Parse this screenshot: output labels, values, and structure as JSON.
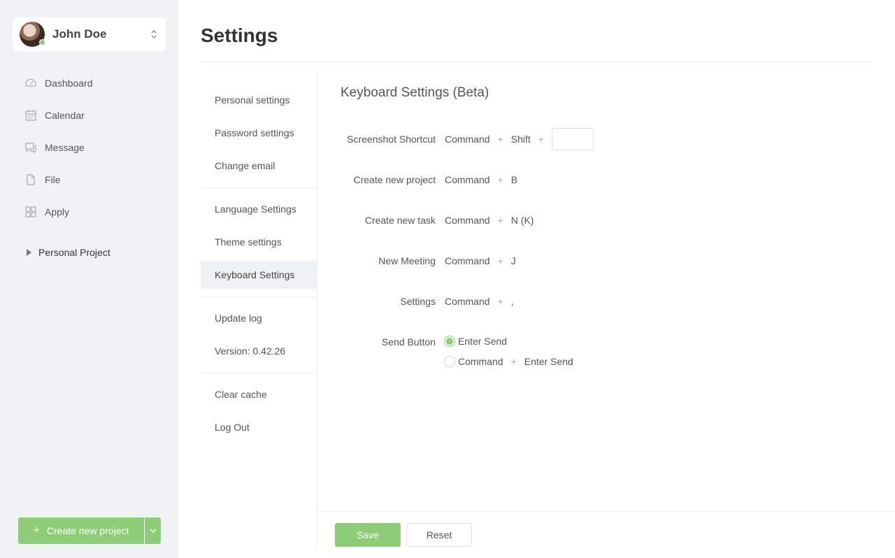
{
  "user": {
    "name": "John Doe"
  },
  "nav": {
    "items": [
      {
        "label": "Dashboard",
        "icon": "dashboard-icon"
      },
      {
        "label": "Calendar",
        "icon": "calendar-icon"
      },
      {
        "label": "Message",
        "icon": "message-icon"
      },
      {
        "label": "File",
        "icon": "file-icon"
      },
      {
        "label": "Apply",
        "icon": "apply-icon"
      }
    ],
    "project": "Personal Project"
  },
  "create_button": {
    "label": "Create new project"
  },
  "page": {
    "title": "Settings"
  },
  "settings_menu": {
    "personal": "Personal settings",
    "password": "Password settings",
    "email": "Change email",
    "language": "Language Settings",
    "theme": "Theme settings",
    "keyboard": "Keyboard Settings",
    "update_log": "Update log",
    "version": "Version: 0.42.26",
    "clear_cache": "Clear cache",
    "logout": "Log Out"
  },
  "keyboard": {
    "title": "Keyboard Settings (Beta)",
    "plus": "+",
    "screenshot": {
      "label": "Screenshot Shortcut",
      "mod1": "Command",
      "mod2": "Shift",
      "key": ""
    },
    "new_project": {
      "label": "Create new project",
      "mod": "Command",
      "key": "B"
    },
    "new_task": {
      "label": "Create new task",
      "mod": "Command",
      "key": "N (K)"
    },
    "new_meeting": {
      "label": "New Meeting",
      "mod": "Command",
      "key": "J"
    },
    "settings": {
      "label": "Settings",
      "mod": "Command",
      "key": ","
    },
    "send_button": {
      "label": "Send Button",
      "option1": "Enter Send",
      "option2_mod": "Command",
      "option2_key": "Enter Send",
      "selected": "option1"
    }
  },
  "footer": {
    "save": "Save",
    "reset": "Reset"
  },
  "colors": {
    "accent": "#8fcc77",
    "sidebar_bg": "#f0f2f5",
    "active_menu_bg": "#eff1f4"
  }
}
